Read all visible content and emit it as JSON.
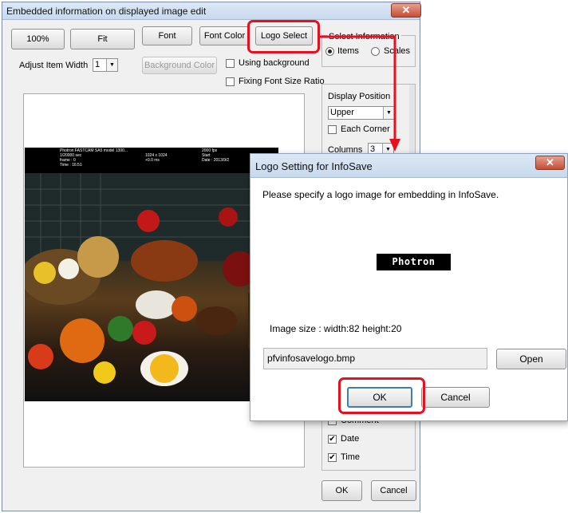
{
  "main_window": {
    "title": "Embedded information on displayed image edit",
    "close_glyph": "✕",
    "buttons": {
      "zoom_100": "100%",
      "fit": "Fit",
      "font": "Font",
      "font_color": "Font Color",
      "logo_select": "Logo Select",
      "background_color": "Background Color",
      "ok": "OK",
      "cancel": "Cancel"
    },
    "adjust_item_width": {
      "label": "Adjust Item Width",
      "value": "1"
    },
    "using_background": {
      "label": "Using background",
      "checked": false
    },
    "fixing_font_size_ratio": {
      "label": "Fixing Font Size Ratio",
      "checked": false
    },
    "select_information": {
      "legend": "Select Information",
      "options": [
        {
          "label": "Items",
          "selected": true
        },
        {
          "label": "Scales",
          "selected": false
        }
      ]
    },
    "display_position": {
      "label": "Display Position",
      "value": "Upper"
    },
    "each_corner": {
      "label": "Each Corner",
      "checked": false
    },
    "columns": {
      "label": "Columns",
      "value": "3"
    },
    "item_list": {
      "partial_label": "Comment",
      "items": [
        {
          "label": "Date",
          "checked": true
        },
        {
          "label": "Time",
          "checked": true
        }
      ]
    },
    "image_overlay": {
      "col1": [
        "Photron FASTCAM SA5 model 1300...",
        "1/20000 sec",
        "frame : 0",
        "Time : 16:51"
      ],
      "col2": [
        "1024 x 1024",
        "+0.0 ms"
      ],
      "col3": [
        "2000 fps",
        "Start",
        "Date : 2013/9/2"
      ]
    }
  },
  "logo_dialog": {
    "title": "Logo Setting for InfoSave",
    "close_glyph": "✕",
    "instruction": "Please specify a logo image for embedding in InfoSave.",
    "logo_text": "Photron",
    "image_size": "Image size  : width:82  height:20",
    "filename": "pfvinfosavelogo.bmp",
    "open_label": "Open",
    "ok_label": "OK",
    "cancel_label": "Cancel"
  },
  "colors": {
    "highlight": "#e8101f",
    "window_bg": "#f0f0f0",
    "titlebar": "#dce8f5",
    "close": "#c74d35"
  },
  "icons": [
    "close-icon",
    "chevron-down-icon",
    "checkmark-icon",
    "radio-dot-icon",
    "arrow-connector-icon"
  ]
}
